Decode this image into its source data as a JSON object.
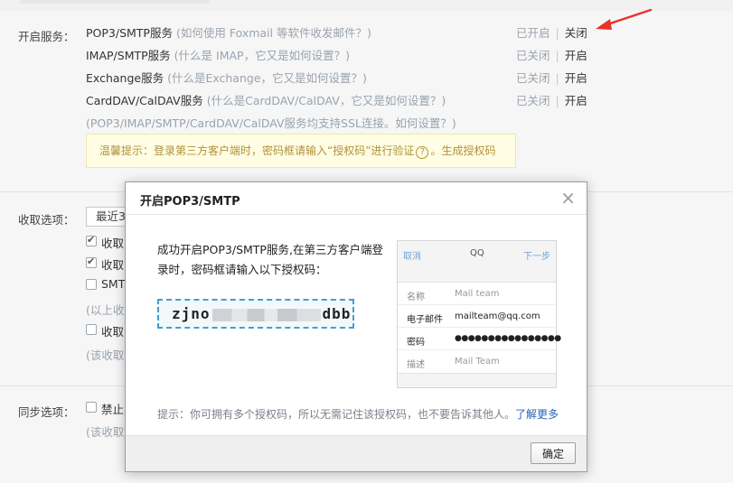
{
  "services": {
    "label": "开启服务：",
    "pop3": {
      "name": "POP3/SMTP服务",
      "hint": "(如何使用 Foxmail 等软件收发邮件？)",
      "status": "已开启",
      "action": "关闭"
    },
    "imap": {
      "name": "IMAP/SMTP服务",
      "hint": "(什么是 IMAP，它又是如何设置？)",
      "status": "已关闭",
      "action": "开启"
    },
    "exchange": {
      "name": "Exchange服务",
      "hint": "(什么是Exchange，它又是如何设置？)",
      "status": "已关闭",
      "action": "开启"
    },
    "carddav": {
      "name": "CardDAV/CalDAV服务",
      "hint": "(什么是CardDAV/CalDAV，它又是如何设置？)",
      "status": "已关闭",
      "action": "开启"
    },
    "ssl_note": "(POP3/IMAP/SMTP/CardDAV/CalDAV服务均支持SSL连接。如何设置？)",
    "tip_prefix": "温馨提示：登录第三方客户端时，密码框请输入“授权码”进行验证",
    "tip_q": "?",
    "tip_link": "。生成授权码"
  },
  "receive": {
    "label": "收取选项：",
    "select_value": "最近3",
    "opt1": "收取",
    "opt2": "收取",
    "opt3": "SMT",
    "note1": "(以上收",
    "opt4": "收取",
    "note2": "(该收取"
  },
  "sync": {
    "label": "同步选项：",
    "opt1": "禁止",
    "note": "(该收取"
  },
  "modal": {
    "title": "开启POP3/SMTP",
    "close": "×",
    "message": "成功开启POP3/SMTP服务,在第三方客户端登录时，密码框请输入以下授权码：",
    "code_start": "zjno",
    "code_end": "dbb",
    "phone": {
      "cancel": "取消",
      "title": "QQ",
      "next": "下一步",
      "rows": [
        {
          "k": "名称",
          "v": "Mail team"
        },
        {
          "k": "电子邮件",
          "v": "mailteam@qq.com"
        },
        {
          "k": "密码",
          "v": "●●●●●●●●●●●●●●●●"
        },
        {
          "k": "描述",
          "v": "Mail Team"
        }
      ]
    },
    "note": "提示：你可拥有多个授权码，所以无需记住该授权码，也不要告诉其他人。",
    "learn_more": "了解更多",
    "ok": "确定"
  },
  "colors": {
    "arrow": "#e8332a",
    "link": "#2a62b6",
    "code_border": "#3fa0d4"
  }
}
